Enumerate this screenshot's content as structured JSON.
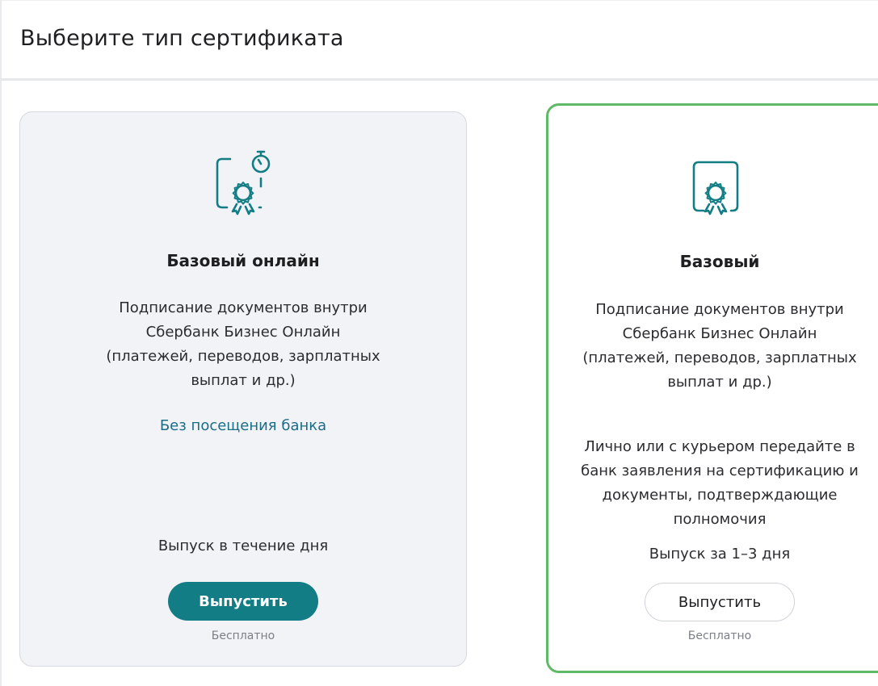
{
  "page": {
    "title": "Выберите тип сертификата"
  },
  "cards": [
    {
      "id": "basic-online",
      "title": "Базовый онлайн",
      "description_lines": [
        "Подписание документов внутри",
        "Сбербанк Бизнес Онлайн",
        "(платежей, переводов, зарплатных",
        "выплат и др.)"
      ],
      "link": "Без посещения банка",
      "issue": "Выпуск в течение дня",
      "button_label": "Выпустить",
      "price": "Бесплатно",
      "icon": "certificate-timer-icon"
    },
    {
      "id": "basic",
      "title": "Базовый",
      "description_lines": [
        "Подписание документов внутри",
        "Сбербанк Бизнес Онлайн",
        "(платежей, переводов, зарплатных",
        "выплат и др.)"
      ],
      "extra_lines": [
        "Лично или с курьером передайте в",
        "банк заявления на сертификацию и",
        "документы, подтверждающие",
        "полномочия"
      ],
      "issue": "Выпуск за 1–3 дня",
      "button_label": "Выпустить",
      "price": "Бесплатно",
      "icon": "certificate-icon",
      "selected": true
    }
  ],
  "colors": {
    "primary": "#137d85",
    "selected_border": "#5fba67",
    "link": "#1a6d87",
    "card_bg": "#f2f3f7",
    "icon_stroke": "#137d85"
  }
}
